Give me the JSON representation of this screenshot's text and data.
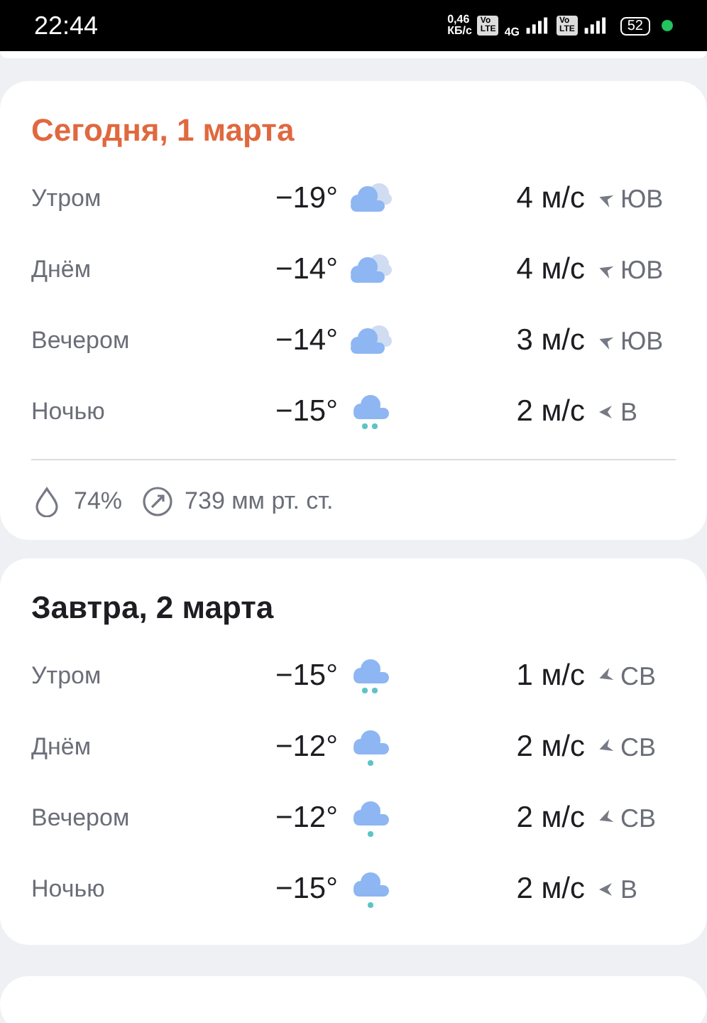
{
  "status_bar": {
    "time": "22:44",
    "speed_value": "0,46",
    "speed_unit": "КБ/с",
    "volte_badges": [
      {
        "top": "Vo",
        "bottom": "LTE"
      },
      {
        "top": "Vo",
        "bottom": "LTE"
      }
    ],
    "network": "4G",
    "battery": "52"
  },
  "days": [
    {
      "title": "Сегодня, 1 марта",
      "highlighted": true,
      "periods": [
        {
          "label": "Утром",
          "temp": "−19°",
          "kind": "cloudy",
          "wind": {
            "speed": "4 м/с",
            "kind": "se",
            "direction": "ЮВ"
          }
        },
        {
          "label": "Днём",
          "temp": "−14°",
          "kind": "cloudy",
          "wind": {
            "speed": "4 м/с",
            "kind": "se",
            "direction": "ЮВ"
          }
        },
        {
          "label": "Вечером",
          "temp": "−14°",
          "kind": "cloudy",
          "wind": {
            "speed": "3 м/с",
            "kind": "se",
            "direction": "ЮВ"
          }
        },
        {
          "label": "Ночью",
          "temp": "−15°",
          "kind": "snow",
          "wind": {
            "speed": "2 м/с",
            "kind": "e",
            "direction": "В"
          }
        }
      ],
      "humidity": "74%",
      "pressure": "739 мм рт. ст."
    },
    {
      "title": "Завтра, 2 марта",
      "highlighted": false,
      "periods": [
        {
          "label": "Утром",
          "temp": "−15°",
          "kind": "snow",
          "wind": {
            "speed": "1 м/с",
            "kind": "ne",
            "direction": "СВ"
          }
        },
        {
          "label": "Днём",
          "temp": "−12°",
          "kind": "flurry",
          "wind": {
            "speed": "2 м/с",
            "kind": "ne",
            "direction": "СВ"
          }
        },
        {
          "label": "Вечером",
          "temp": "−12°",
          "kind": "flurry",
          "wind": {
            "speed": "2 м/с",
            "kind": "ne",
            "direction": "СВ"
          }
        },
        {
          "label": "Ночью",
          "temp": "−15°",
          "kind": "flurry",
          "wind": {
            "speed": "2 м/с",
            "kind": "e",
            "direction": "В"
          }
        }
      ]
    }
  ]
}
